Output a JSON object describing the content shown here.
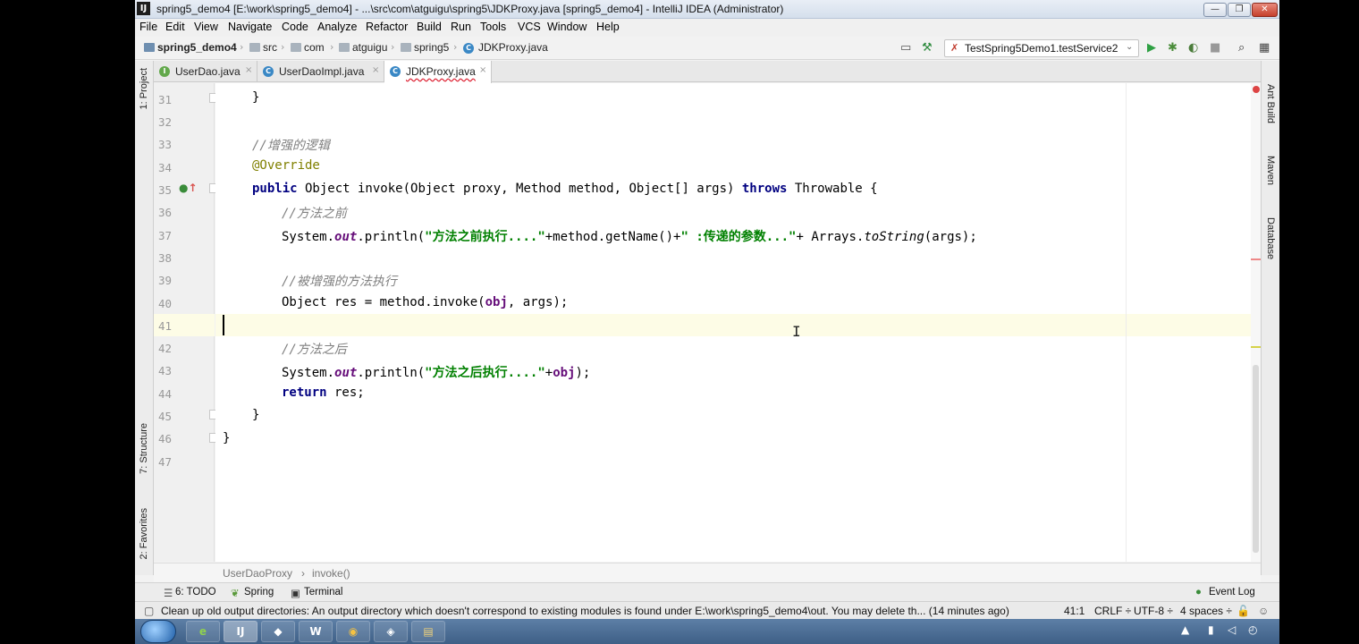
{
  "window": {
    "title": "spring5_demo4 [E:\\work\\spring5_demo4] - ...\\src\\com\\atguigu\\spring5\\JDKProxy.java [spring5_demo4] - IntelliJ IDEA (Administrator)",
    "app_icon": "IJ"
  },
  "menu": [
    "File",
    "Edit",
    "View",
    "Navigate",
    "Code",
    "Analyze",
    "Refactor",
    "Build",
    "Run",
    "Tools",
    "VCS",
    "Window",
    "Help"
  ],
  "nav": {
    "project": "spring5_demo4",
    "crumbs": [
      "src",
      "com",
      "atguigu",
      "spring5",
      "JDKProxy.java"
    ],
    "run_config": "TestSpring5Demo1.testService2"
  },
  "tabs": [
    {
      "label": "UserDao.java",
      "badge": "I"
    },
    {
      "label": "UserDaoImpl.java",
      "badge": "C"
    },
    {
      "label": "JDKProxy.java",
      "badge": "C"
    }
  ],
  "left_tools": [
    "1: Project",
    "7: Structure",
    "2: Favorites"
  ],
  "right_tools": [
    "Ant Build",
    "Maven",
    "Database"
  ],
  "code_lines": [
    {
      "n": "31"
    },
    {
      "n": "32"
    },
    {
      "n": "33"
    },
    {
      "n": "34"
    },
    {
      "n": "35"
    },
    {
      "n": "36"
    },
    {
      "n": "37"
    },
    {
      "n": "38"
    },
    {
      "n": "39"
    },
    {
      "n": "40"
    },
    {
      "n": "41"
    },
    {
      "n": "42"
    },
    {
      "n": "43"
    },
    {
      "n": "44"
    },
    {
      "n": "45"
    },
    {
      "n": "46"
    },
    {
      "n": "47"
    }
  ],
  "code": {
    "l31": "}",
    "l33": "//增强的逻辑",
    "l34": "@Override",
    "l35_kw": "public",
    "l35_sig": " Object invoke(Object proxy, Method method, Object[] args) ",
    "l35_throws": "throws",
    "l35_end": " Throwable {",
    "l36": "//方法之前",
    "l37_a": "System.",
    "l37_out": "out",
    "l37_b": ".println(",
    "l37_s1": "\"方法之前执行....\"",
    "l37_c": "+method.getName()+",
    "l37_s2": "\" :传递的参数...\"",
    "l37_d": "+ Arrays.",
    "l37_ts": "toString",
    "l37_e": "(args);",
    "l39": "//被增强的方法执行",
    "l40_a": "Object res = method.invoke(",
    "l40_obj": "obj",
    "l40_b": ", args);",
    "l42": "//方法之后",
    "l43_a": "System.",
    "l43_out": "out",
    "l43_b": ".println(",
    "l43_s": "\"方法之后执行....\"",
    "l43_c": "+",
    "l43_obj": "obj",
    "l43_d": ");",
    "l44_kw": "return",
    "l44_b": " res;",
    "l45": "}",
    "l46": "}"
  },
  "breadcrumb": [
    "UserDaoProxy",
    "invoke()"
  ],
  "tool_windows": {
    "todo": "6: TODO",
    "spring": "Spring",
    "terminal": "Terminal",
    "event_log": "Event Log"
  },
  "status": {
    "message": "Clean up old output directories: An output directory which doesn't correspond to existing modules is found under E:\\work\\spring5_demo4\\out. You may delete th... (14 minutes ago)",
    "position": "41:1",
    "line_sep": "CRLF ÷",
    "encoding": "UTF-8 ÷",
    "indent": "4 spaces ÷"
  },
  "colors": {
    "keyword": "#000080",
    "comment": "#808080",
    "string": "#008000",
    "annotation": "#808000",
    "field": "#660e7a",
    "current_line": "#fdfce6"
  }
}
